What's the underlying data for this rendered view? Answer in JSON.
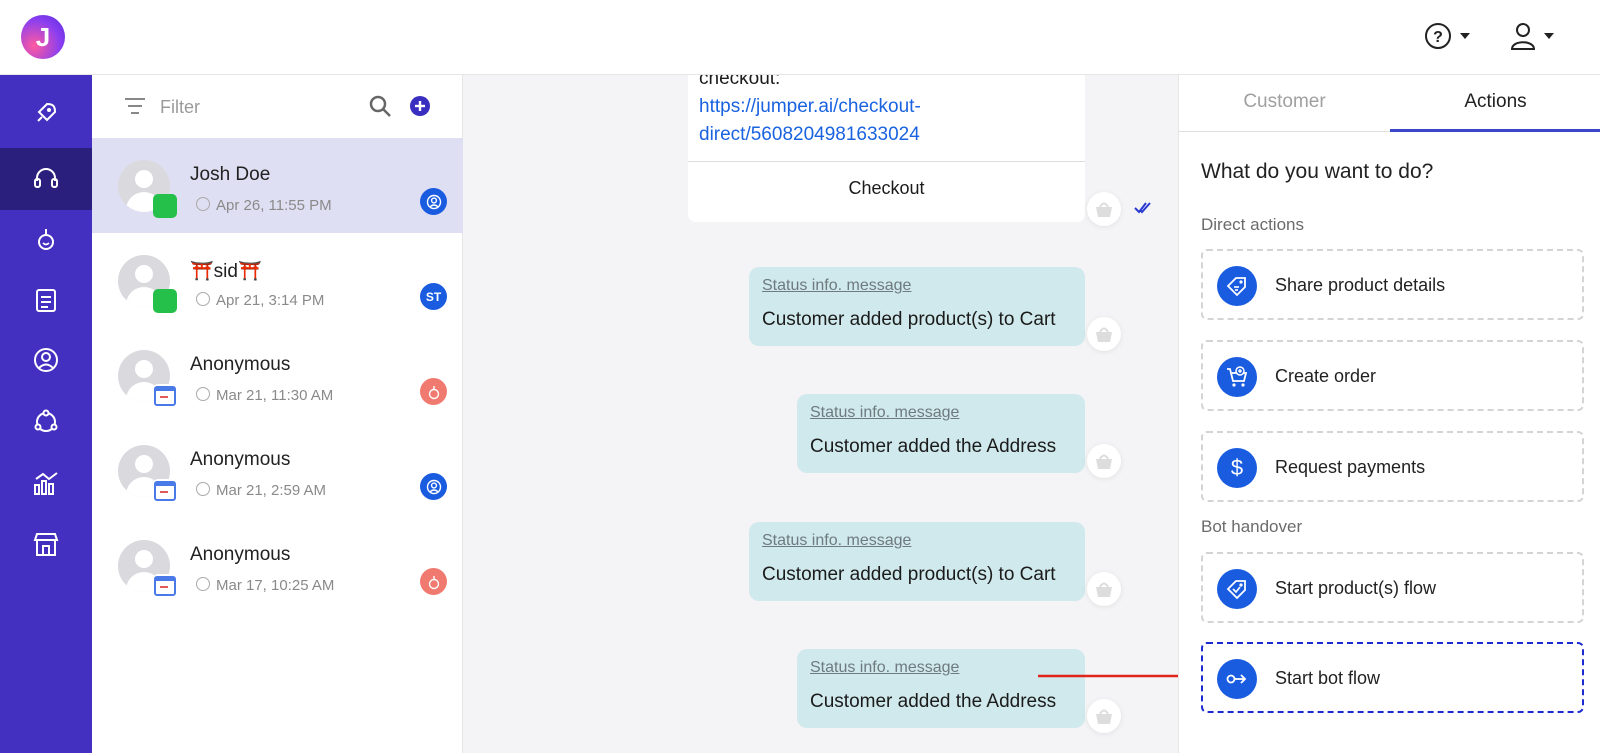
{
  "app": {
    "logo_letter": "J"
  },
  "filter": {
    "label": "Filter"
  },
  "conversations": [
    {
      "name": "Josh Doe",
      "time": "Apr 26, 11:55 PM",
      "channel": "whatsapp",
      "agent": "agent-icon",
      "agent_color": "#1a5ce0"
    },
    {
      "name": "⛩️sid⛩️",
      "time": "Apr 21, 3:14 PM",
      "channel": "whatsapp",
      "agent": "ST",
      "agent_color": "#1a5ce0"
    },
    {
      "name": "Anonymous",
      "time": "Mar 21, 11:30 AM",
      "channel": "web",
      "agent": "bot-icon",
      "agent_color": "#f07a70"
    },
    {
      "name": "Anonymous",
      "time": "Mar 21, 2:59 AM",
      "channel": "web",
      "agent": "agent-icon",
      "agent_color": "#1a5ce0"
    },
    {
      "name": "Anonymous",
      "time": "Mar 17, 10:25 AM",
      "channel": "web",
      "agent": "bot-icon",
      "agent_color": "#f07a70"
    }
  ],
  "chat": {
    "card": {
      "prefix": "checkout:",
      "link_line1": "https://jumper.ai/checkout-",
      "link_line2": "direct/5608204981633024",
      "button": "Checkout"
    },
    "messages": [
      {
        "title": "Status info. message",
        "text": "Customer added product(s) to Cart"
      },
      {
        "title": "Status info. message",
        "text": "Customer added the Address"
      },
      {
        "title": "Status info. message",
        "text": "Customer added product(s) to Cart"
      },
      {
        "title": "Status info. message",
        "text": "Customer added the Address"
      }
    ]
  },
  "panel": {
    "tabs": [
      "Customer",
      "Actions"
    ],
    "question": "What do you want to do?",
    "direct_title": "Direct actions",
    "direct": [
      "Share product details",
      "Create order",
      "Request payments"
    ],
    "bot_title": "Bot handover",
    "bot": [
      "Start product(s) flow",
      "Start bot flow"
    ]
  },
  "colors": {
    "nav": "#4430c0",
    "accent": "#1a5ce0",
    "highlight": "#1b2bd0"
  }
}
